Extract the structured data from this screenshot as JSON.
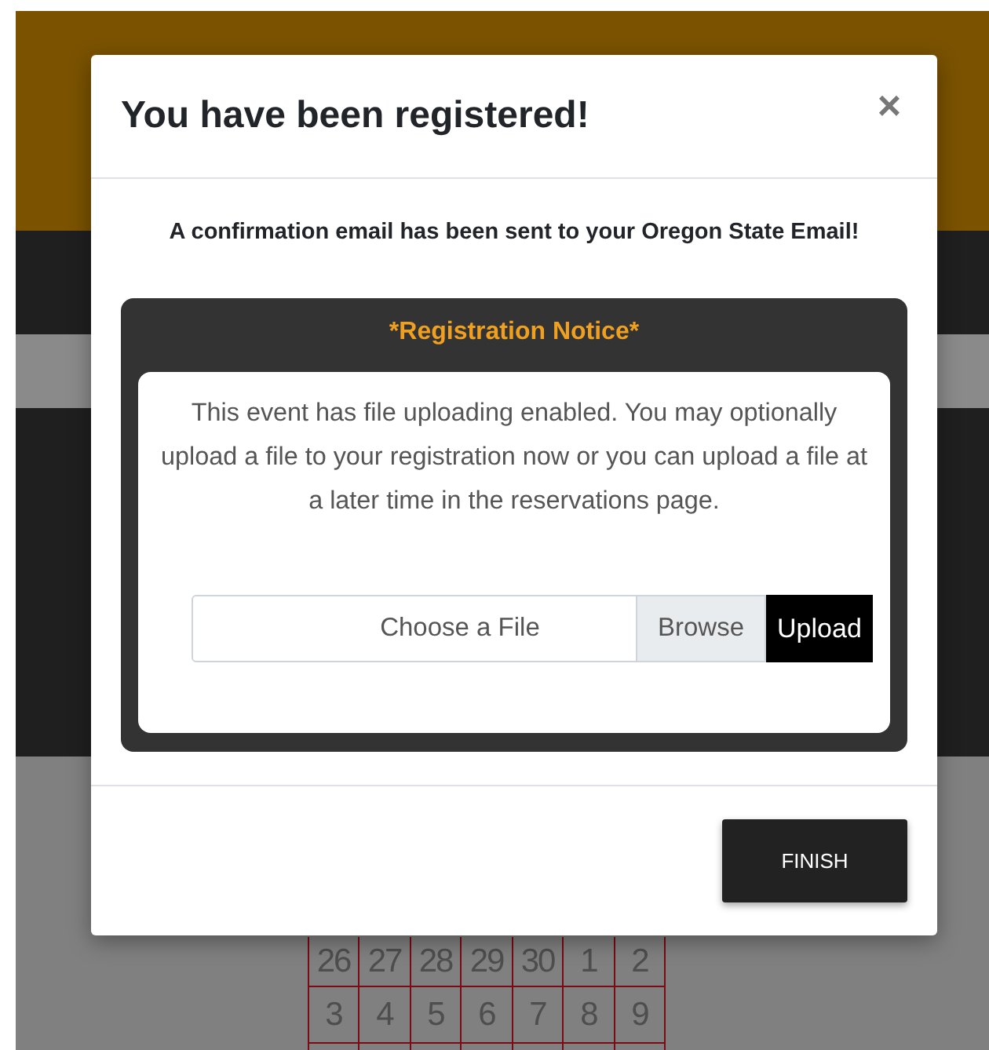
{
  "calendar": {
    "rows": [
      [
        "26",
        "27",
        "28",
        "29",
        "30",
        "1",
        "2"
      ],
      [
        "3",
        "4",
        "5",
        "6",
        "7",
        "8",
        "9"
      ]
    ]
  },
  "modal": {
    "title": "You have been registered!",
    "close": "×",
    "message": "A confirmation email has been sent to your Oregon State Email!",
    "notice": {
      "title": "*Registration Notice*",
      "text": "This event has file uploading enabled. You may optionally upload a file to your registration now or you can upload a file at a later time in the reservations page.",
      "file_input": {
        "placeholder": "Choose a File",
        "browse": "Browse",
        "upload": "Upload"
      }
    },
    "finish": "FINISH"
  }
}
